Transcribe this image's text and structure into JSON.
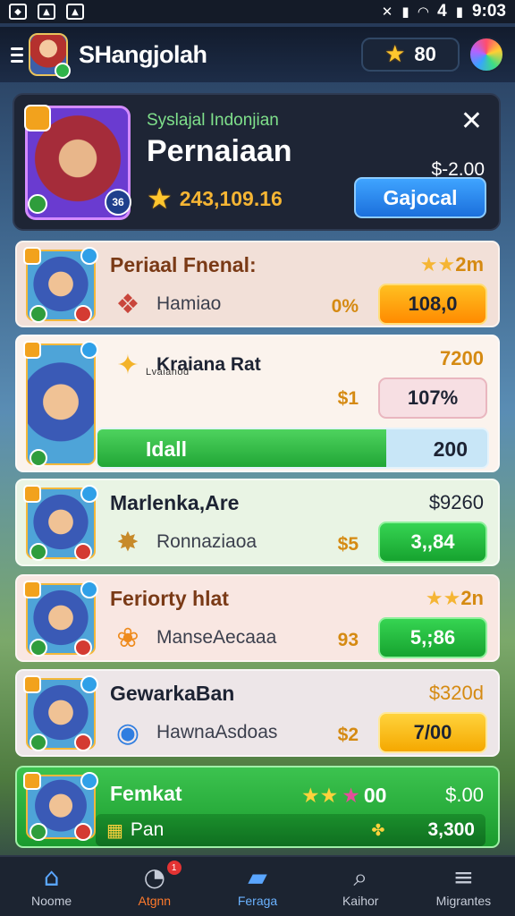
{
  "status_bar": {
    "time": "9:03",
    "signal_text": "4",
    "left_icons": [
      "notification-icon",
      "image-icon",
      "gallery-icon"
    ]
  },
  "header": {
    "title": "SHangjolah",
    "coins": "80"
  },
  "featured": {
    "subtitle": "Syslajal Indonjian",
    "title": "Pernaiaan",
    "score": "243,109.16",
    "price": "$-2.00",
    "button_label": "Gajocal",
    "badge_number": "36"
  },
  "rows": [
    {
      "title": "Periaal Fnenal:",
      "subtitle": "Hamiao",
      "top_right": "2m",
      "mid_value": "0%",
      "button_label": "108,0",
      "item_icon": "gift-icon"
    },
    {
      "title": "Kraiana Rat",
      "subtitle": "Lvaianod",
      "top_right": "7200",
      "mid_value": "$1",
      "button_label": "107%",
      "item_icon": "star-emblem-icon",
      "progress_label": "Idall",
      "progress_value": "200",
      "progress_fraction": 0.74
    },
    {
      "title": "Marlenka,Are",
      "subtitle": "Ronnaziaoa",
      "top_right": "$9260",
      "mid_value": "$5",
      "button_label": "3,,84",
      "item_icon": "treasure-icon"
    },
    {
      "title": "Feriorty hlat",
      "subtitle": "ManseAecaaa",
      "top_right": "2n",
      "mid_value": "93",
      "button_label": "5,;86",
      "item_icon": "shell-icon"
    },
    {
      "title": "GewarkaBan",
      "subtitle": "HawnaAsdoas",
      "top_right": "$320d",
      "mid_value": "$2",
      "button_label": "7/00",
      "item_icon": "orb-icon"
    },
    {
      "title": "Femkat",
      "stars_value": "00",
      "top_right": "$.00",
      "bar_label": "Pan",
      "bar_value": "3,300"
    }
  ],
  "bottom_nav": [
    {
      "label": "Noome",
      "icon": "home-icon"
    },
    {
      "label": "Atgnn",
      "icon": "timer-icon",
      "badge": "1"
    },
    {
      "label": "Feraga",
      "icon": "cards-icon"
    },
    {
      "label": "Kaihor",
      "icon": "search-icon"
    },
    {
      "label": "Migrantes",
      "icon": "menu-icon"
    }
  ]
}
